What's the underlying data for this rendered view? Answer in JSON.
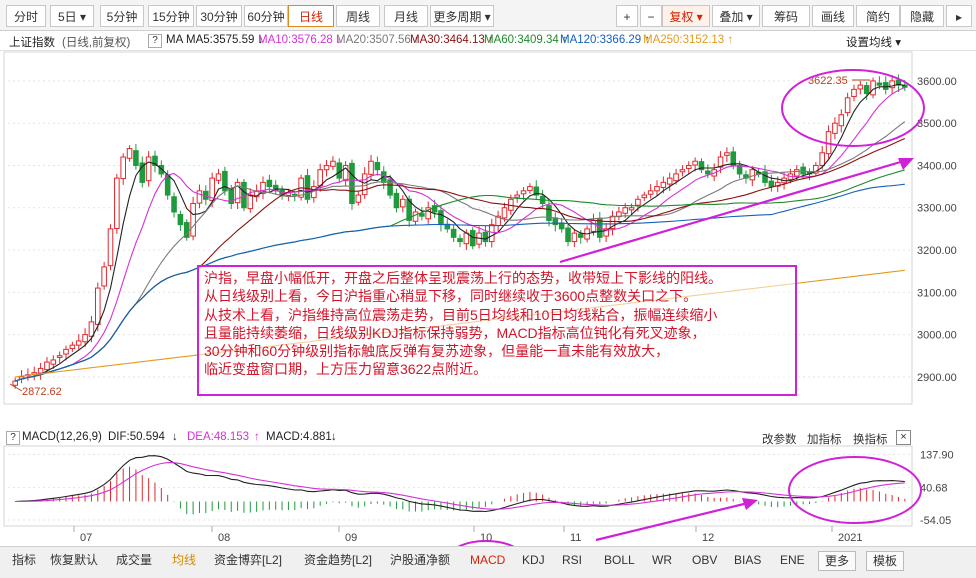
{
  "toolbar": {
    "periods": [
      "分时",
      "5日 ▾",
      "5分钟",
      "15分钟",
      "30分钟",
      "60分钟",
      "日线",
      "周线",
      "月线",
      "更多周期 ▾"
    ],
    "active_period": "日线",
    "right": [
      "+",
      "−",
      "复权 ▾",
      "叠加 ▾",
      "筹码",
      "画线",
      "简约",
      "隐藏"
    ]
  },
  "ma_bar": {
    "title": "上证指数",
    "subtitle": "(日线,前复权)",
    "q": "?",
    "ma_label": "MA",
    "settings": "设置均线 ▾",
    "items": [
      {
        "text": "MA5:3575.59",
        "arrow": "↓",
        "color": "#222222"
      },
      {
        "text": "MA10:3576.28",
        "arrow": "↓",
        "color": "#d432d6"
      },
      {
        "text": "MA20:3507.56",
        "arrow": "↑",
        "color": "#7a7a7a"
      },
      {
        "text": "MA30:3464.13",
        "arrow": "↑",
        "color": "#8b1010"
      },
      {
        "text": "MA60:3409.34",
        "arrow": "↑",
        "color": "#1e8a2c"
      },
      {
        "text": "MA120:3366.29",
        "arrow": "↑",
        "color": "#1560bd"
      },
      {
        "text": "MA250:3152.13",
        "arrow": "↑",
        "color": "#e39a1c"
      }
    ]
  },
  "price_axis": [
    "3600.00",
    "3500.00",
    "3400.00",
    "3300.00",
    "3200.00",
    "3100.00",
    "3000.00",
    "2900.00"
  ],
  "price_marks": {
    "high": "3622.35",
    "low": "2872.62"
  },
  "annotation": [
    "沪指，早盘小幅低开，开盘之后整体呈现震荡上行的态势，收带短上下影线的阳线。",
    "从日线级别上看，今日沪指重心稍显下移，同时继续收于3600点整数关口之下。",
    "从技术上看，沪指维持高位震荡走势，目前5日均线和10日均线粘合，振幅连续缩小",
    "且量能持续萎缩，日线级别KDJ指标保持弱势，MACD指标高位钝化有死叉迹象，",
    "30分钟和60分钟级别指标触底反弹有复苏迹象，但量能一直未能有效放大，",
    "临近变盘窗口期，上方压力留意3622点附近。"
  ],
  "macd_bar": {
    "q": "?",
    "name": "MACD(12,26,9)",
    "dif": "DIF:50.594",
    "dif_arrow": "↓",
    "dea": "DEA:48.153",
    "dea_arrow": "↑",
    "macd": "MACD:4.881",
    "macd_arrow": "↓",
    "buttons": [
      "改参数",
      "加指标",
      "换指标"
    ]
  },
  "macd_axis": [
    "137.90",
    "40.68",
    "-54.05"
  ],
  "months": [
    "07",
    "08",
    "09",
    "10",
    "11",
    "12",
    "2021"
  ],
  "bottom_tabs": [
    "指标",
    "恢复默认",
    "成交量",
    "均线",
    "资金博弈[L2]",
    "资金趋势[L2]",
    "沪股通净额",
    "MACD",
    "KDJ",
    "RSI",
    "BOLL",
    "WR",
    "OBV",
    "BIAS",
    "ENE",
    "更多",
    "模板"
  ],
  "colors": {
    "up": "#e0282e",
    "down": "#1f9a3c",
    "accent": "#d020d8",
    "ma5": "#222222",
    "ma10": "#d432d6",
    "ma20": "#7a7a7a",
    "ma30": "#8b1010",
    "ma60": "#1e8a2c",
    "ma120": "#1560bd",
    "ma250": "#e39a1c"
  },
  "chart_data": {
    "type": "candlestick",
    "price_range": [
      2872.62,
      3622.35
    ],
    "months": [
      "07",
      "08",
      "09",
      "10",
      "11",
      "12",
      "2021"
    ],
    "candles": [
      2890,
      2900,
      2905,
      2910,
      2920,
      2935,
      2940,
      2950,
      2965,
      2975,
      2985,
      3000,
      3030,
      3110,
      3160,
      3250,
      3370,
      3420,
      3440,
      3400,
      3360,
      3420,
      3400,
      3380,
      3330,
      3290,
      3260,
      3230,
      3310,
      3340,
      3320,
      3370,
      3380,
      3340,
      3310,
      3360,
      3300,
      3330,
      3340,
      3360,
      3350,
      3340,
      3330,
      3335,
      3330,
      3370,
      3320,
      3350,
      3390,
      3400,
      3410,
      3370,
      3400,
      3310,
      3330,
      3380,
      3410,
      3390,
      3360,
      3330,
      3300,
      3320,
      3270,
      3290,
      3280,
      3300,
      3290,
      3260,
      3250,
      3230,
      3220,
      3240,
      3210,
      3240,
      3220,
      3260,
      3280,
      3300,
      3320,
      3330,
      3340,
      3350,
      3330,
      3310,
      3270,
      3260,
      3250,
      3220,
      3240,
      3230,
      3250,
      3270,
      3230,
      3250,
      3280,
      3290,
      3300,
      3300,
      3320,
      3330,
      3340,
      3350,
      3360,
      3370,
      3380,
      3390,
      3400,
      3410,
      3390,
      3380,
      3390,
      3420,
      3430,
      3400,
      3380,
      3370,
      3390,
      3380,
      3360,
      3350,
      3360,
      3370,
      3380,
      3390,
      3380,
      3380,
      3400,
      3430,
      3480,
      3500,
      3520,
      3560,
      3580,
      3590,
      3570,
      3600,
      3590,
      3580,
      3600,
      3590,
      3585
    ],
    "ma_series": [
      "MA5",
      "MA10",
      "MA20",
      "MA30",
      "MA60",
      "MA120",
      "MA250"
    ]
  }
}
